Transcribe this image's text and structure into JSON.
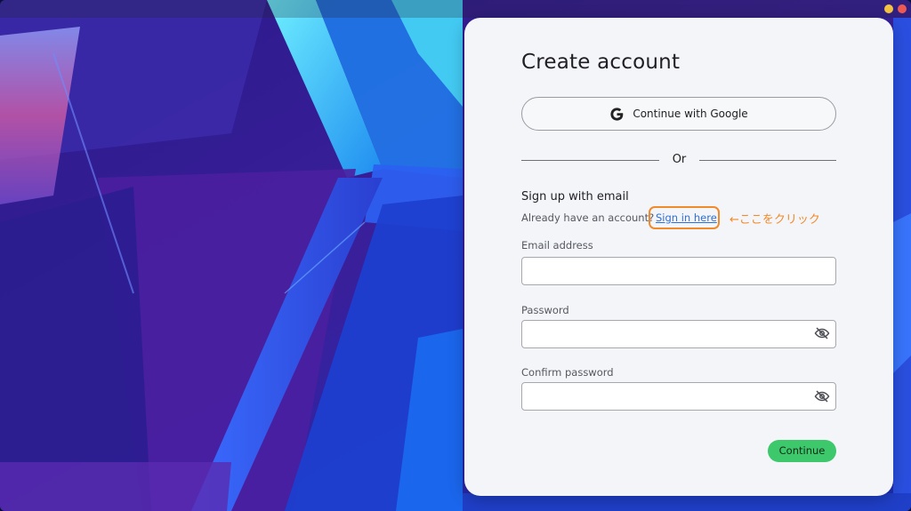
{
  "form": {
    "title": "Create account",
    "google_label": "Continue with Google",
    "divider_text": "Or",
    "section_heading": "Sign up with email",
    "have_account_text": "Already have an account?",
    "sign_in_link": "Sign in here",
    "annotation": "←ここをクリック",
    "email_label": "Email address",
    "email_value": "",
    "password_label": "Password",
    "password_value": "",
    "confirm_label": "Confirm password",
    "confirm_value": "",
    "continue_label": "Continue"
  },
  "colors": {
    "accent_green": "#3dc86b",
    "link_blue": "#2f6fd6",
    "annotation_orange": "#f08a2a"
  },
  "icons": {
    "google": "google-g-icon",
    "password_visibility": "eye-off-icon"
  }
}
